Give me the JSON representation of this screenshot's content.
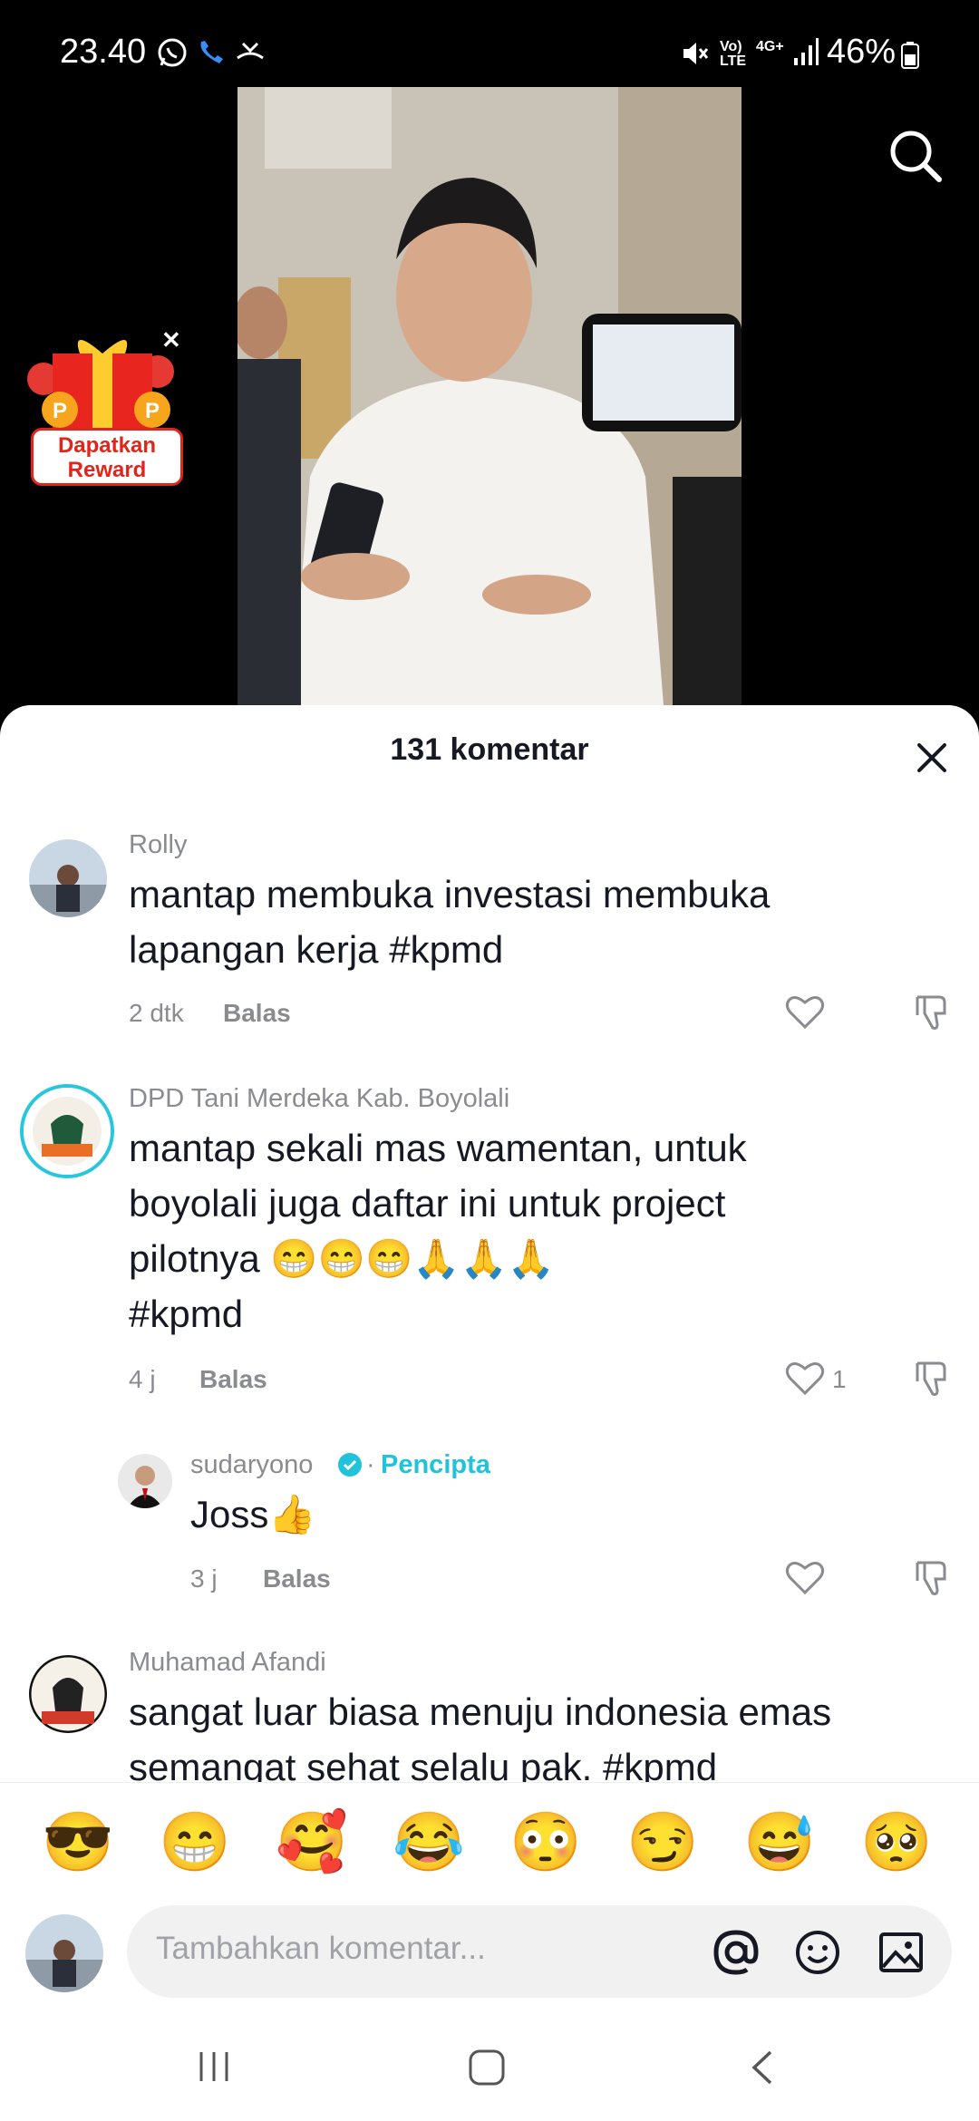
{
  "status_bar": {
    "time": "23.40",
    "battery": "46%",
    "network_vol": "Vo)\nLTE",
    "network_4g": "4G+"
  },
  "reward": {
    "line1": "Dapatkan",
    "line2": "Reward"
  },
  "sheet": {
    "title": "131 komentar"
  },
  "comments": [
    {
      "username": "Rolly",
      "text": "mantap membuka investasi membuka lapangan kerja #kpmd",
      "time": "2 dtk",
      "reply_label": "Balas",
      "likes": ""
    },
    {
      "username": "DPD Tani Merdeka Kab. Boyolali",
      "text_line1": "mantap sekali mas wamentan, untuk",
      "text_line2": "boyolali juga daftar ini untuk project",
      "text_line3": "pilotnya 😁😁😁🙏🙏🙏",
      "text_line4": "#kpmd",
      "time": "4 j",
      "reply_label": "Balas",
      "likes": "1"
    },
    {
      "username": "sudaryono",
      "creator_label": "Pencipta",
      "text": "Joss👍",
      "time": "3 j",
      "reply_label": "Balas",
      "likes": ""
    },
    {
      "username": "Muhamad Afandi",
      "text_line1": "sangat luar biasa menuju indonesia emas",
      "text_line2": "semangat sehat selalu pak. #kpmd"
    }
  ],
  "emoji_bar": [
    "😎",
    "😁",
    "🥰",
    "😂",
    "😳",
    "😏",
    "😅",
    "🥺"
  ],
  "input": {
    "placeholder": "Tambahkan komentar..."
  },
  "colors": {
    "accent": "#20c3d9",
    "text": "#161823",
    "muted": "#8a8b91"
  }
}
